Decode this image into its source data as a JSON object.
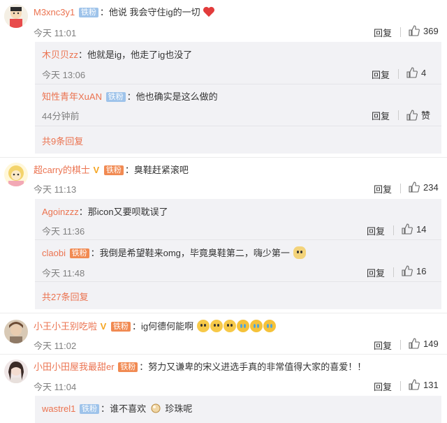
{
  "ui": {
    "reply_label": "回复",
    "badge_fan": "铁粉",
    "badge_vip": "铁粉"
  },
  "comments": [
    {
      "username": "M3xnc3y1",
      "text": "他说 我会守住ig的一切",
      "time": "今天 11:01",
      "likes": "369",
      "subreplies": [
        {
          "username": "木贝贝zz",
          "text": "他就是ig，他走了ig也没了",
          "time": "今天 13:06",
          "likes": "4"
        },
        {
          "username": "知性青年XuAN",
          "text": "他也确实是这么做的",
          "time": "44分钟前",
          "likes": "赞"
        }
      ],
      "more_label": "共9条回复"
    },
    {
      "username": "超carry的棋士",
      "text": "臭鞋赶紧滚吧",
      "time": "今天 11:13",
      "likes": "234",
      "subreplies": [
        {
          "username": "Agoinzzz",
          "text": "那icon又要呗耽误了",
          "time": "今天 11:36",
          "likes": "14"
        },
        {
          "username": "claobi",
          "text": "我倒是希望鞋来omg，毕竟臭鞋第二，嗨少第一",
          "time": "今天 11:48",
          "likes": "16"
        }
      ],
      "more_label": "共27条回复"
    },
    {
      "username": "小王小王别吃啦",
      "text": "ig何德何能啊",
      "time": "今天 11:02",
      "likes": "149"
    },
    {
      "username": "小田小田屋我最甜er",
      "text": "努力又谦卑的宋义进选手真的非常值得大家的喜爱！！",
      "time": "今天 11:04",
      "likes": "131",
      "subreplies": [
        {
          "username": "wastrel1",
          "text": "谁不喜欢",
          "text2": "珍珠呢"
        }
      ]
    }
  ]
}
